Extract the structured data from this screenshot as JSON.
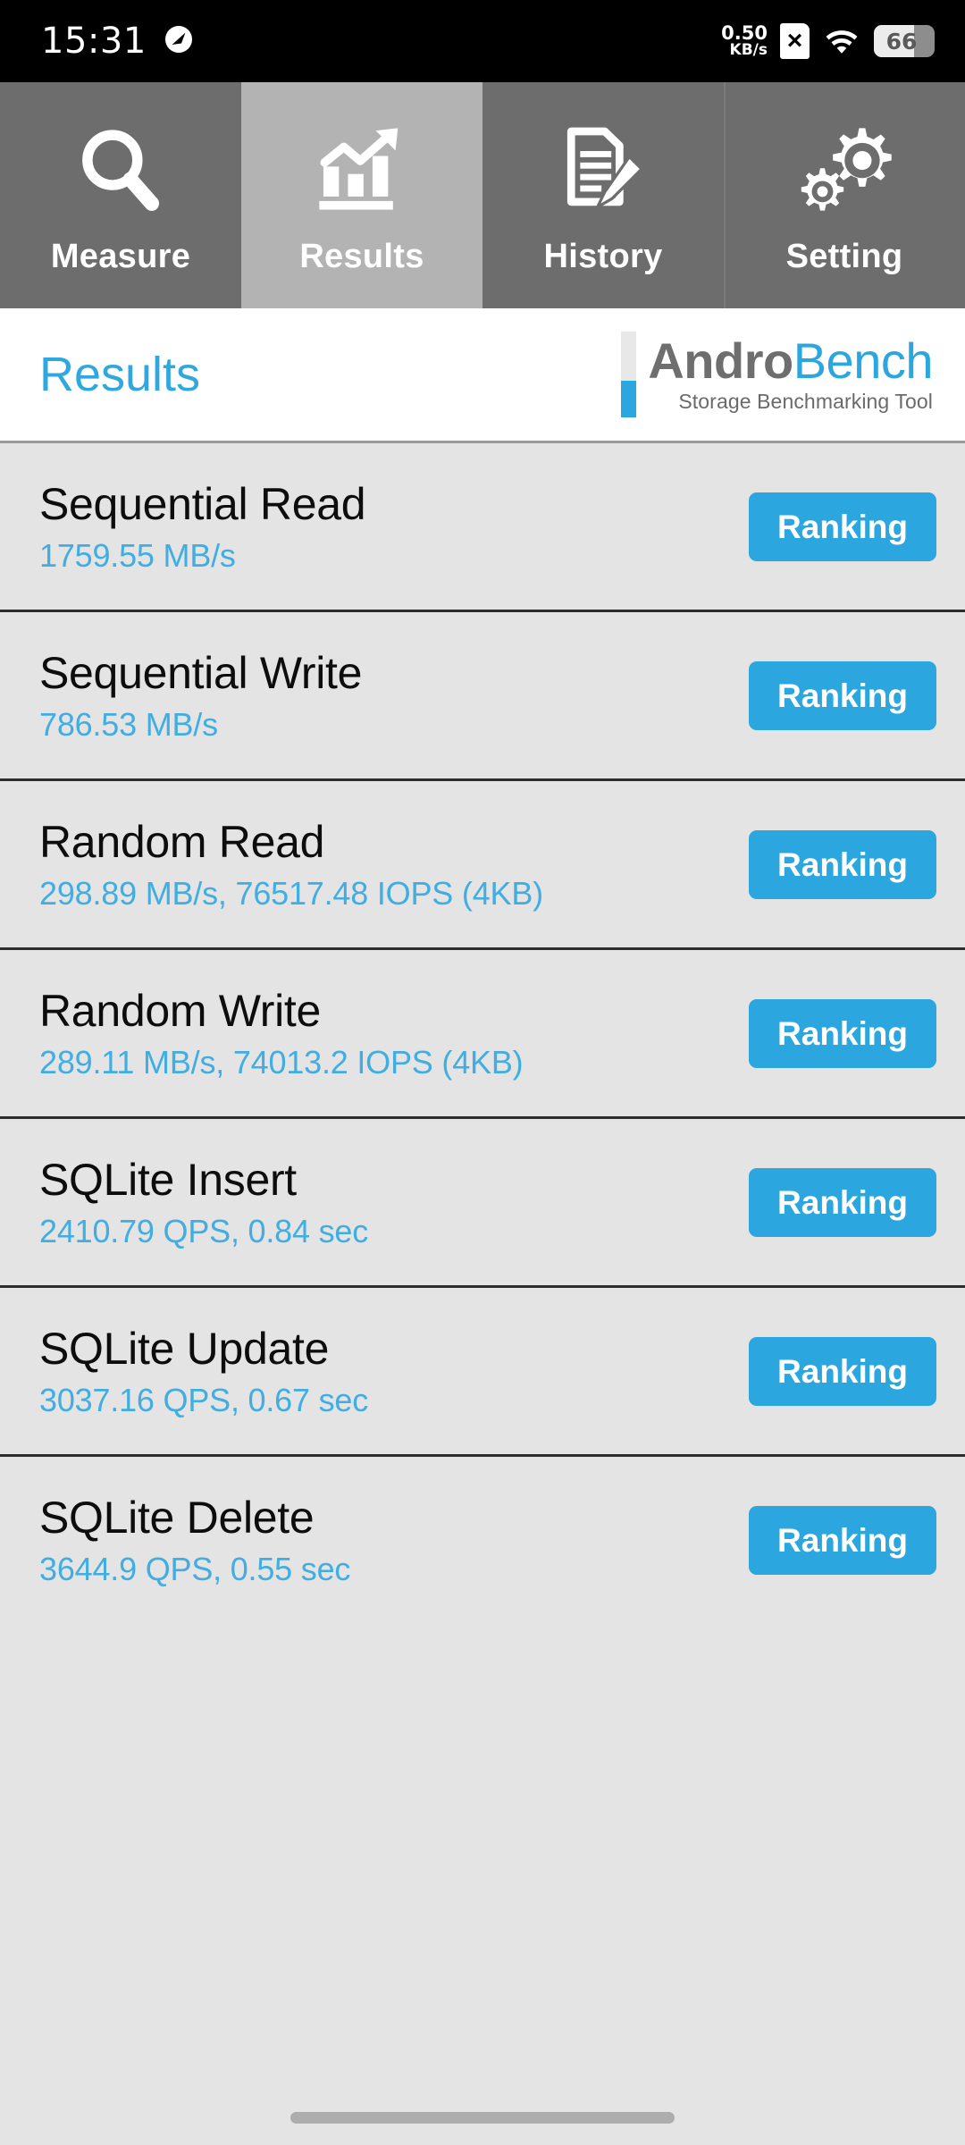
{
  "status_bar": {
    "time": "15:31",
    "speed_icon": "speedometer-icon",
    "network_speed_value": "0.50",
    "network_speed_unit": "KB/s",
    "sim_icon": "sim-card-no-service-icon",
    "wifi_icon": "wifi-icon",
    "battery_level": "66"
  },
  "tabs": [
    {
      "label": "Measure",
      "icon": "magnifier-icon",
      "active": false
    },
    {
      "label": "Results",
      "icon": "bar-chart-arrow-icon",
      "active": true
    },
    {
      "label": "History",
      "icon": "document-pencil-icon",
      "active": false
    },
    {
      "label": "Setting",
      "icon": "gears-icon",
      "active": false
    }
  ],
  "header": {
    "title": "Results",
    "logo_primary": "Andro",
    "logo_secondary": "Bench",
    "logo_tagline": "Storage Benchmarking Tool"
  },
  "results": [
    {
      "title": "Sequential Read",
      "value": "1759.55 MB/s",
      "button": "Ranking"
    },
    {
      "title": "Sequential Write",
      "value": "786.53 MB/s",
      "button": "Ranking"
    },
    {
      "title": "Random Read",
      "value": "298.89 MB/s, 76517.48 IOPS (4KB)",
      "button": "Ranking"
    },
    {
      "title": "Random Write",
      "value": "289.11 MB/s, 74013.2 IOPS (4KB)",
      "button": "Ranking"
    },
    {
      "title": "SQLite Insert",
      "value": "2410.79 QPS, 0.84 sec",
      "button": "Ranking"
    },
    {
      "title": "SQLite Update",
      "value": "3037.16 QPS, 0.67 sec",
      "button": "Ranking"
    },
    {
      "title": "SQLite Delete",
      "value": "3644.9 QPS, 0.55 sec",
      "button": "Ranking"
    }
  ],
  "colors": {
    "accent_blue": "#2ba6de",
    "value_blue": "#41ade0",
    "tab_inactive": "#6d6d6d",
    "tab_active": "#b3b3b3",
    "list_background": "#e4e4e4",
    "separator": "#2d2d2d"
  }
}
